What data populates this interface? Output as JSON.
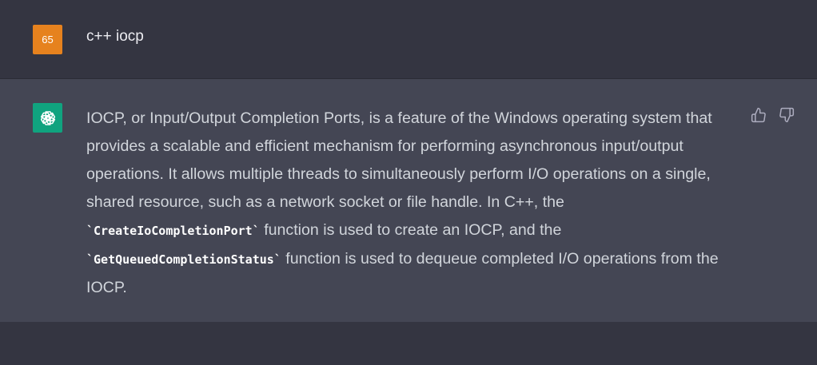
{
  "user_message": {
    "avatar_initials": "65",
    "text": "c++ iocp"
  },
  "assistant_message": {
    "part1": "IOCP, or Input/Output Completion Ports, is a feature of the Windows operating system that provides a scalable and efficient mechanism for performing asynchronous input/output operations. It allows multiple threads to simultaneously perform I/O operations on a single, shared resource, such as a network socket or file handle. In C++, the ",
    "code1": "`CreateIoCompletionPort`",
    "part2": " function is used to create an IOCP, and the ",
    "code2": "`GetQueuedCompletionStatus`",
    "part3": " function is used to dequeue completed I/O operations from the IOCP."
  },
  "icons": {
    "assistant_avatar": "openai-logo-icon",
    "feedback_up": "thumbs-up-icon",
    "feedback_down": "thumbs-down-icon"
  },
  "colors": {
    "user_avatar_bg": "#e6821e",
    "assistant_avatar_bg": "#10a37f",
    "user_row_bg": "#343541",
    "assistant_row_bg": "#444654"
  }
}
